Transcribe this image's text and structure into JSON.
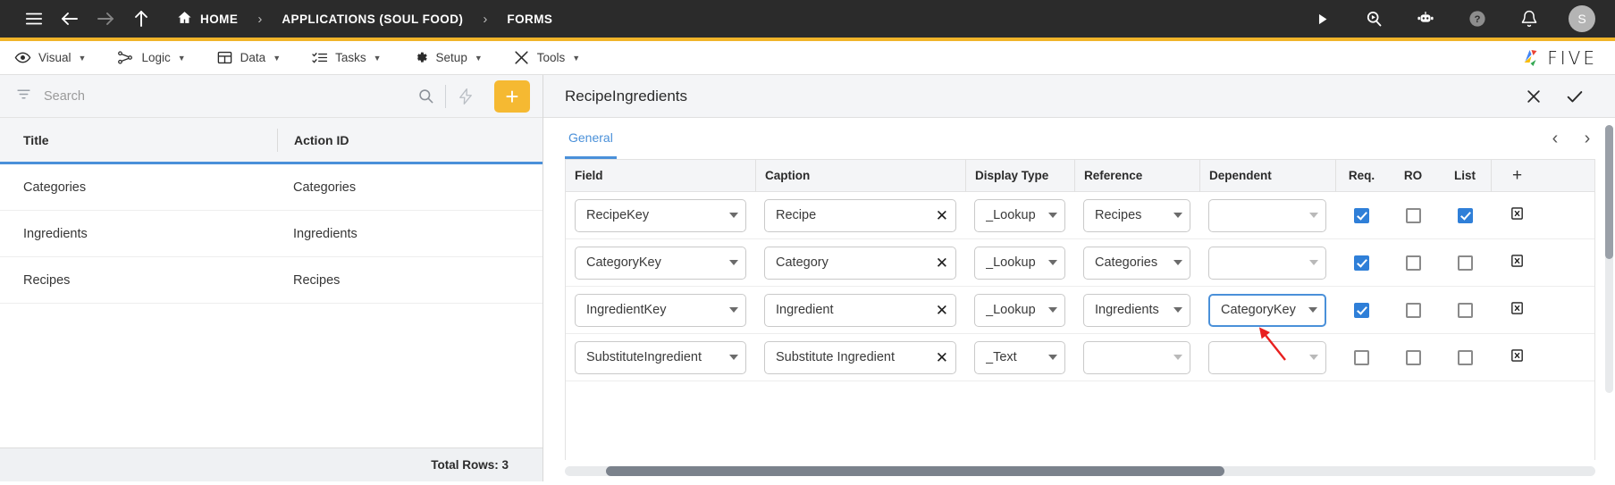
{
  "topbar": {
    "icons": {
      "menu": "hamburger-menu-icon",
      "back": "back-arrow-icon",
      "forward": "forward-arrow-icon",
      "up": "up-arrow-icon"
    },
    "breadcrumbs": [
      {
        "label": "HOME",
        "icon": "home-icon"
      },
      {
        "label": "APPLICATIONS (SOUL FOOD)",
        "icon": ""
      },
      {
        "label": "FORMS",
        "icon": ""
      }
    ],
    "separator": "›",
    "right_icons": [
      {
        "name": "play-icon"
      },
      {
        "name": "search-run-icon"
      },
      {
        "name": "chatbot-icon"
      },
      {
        "name": "help-icon"
      },
      {
        "name": "notifications-bell-icon"
      }
    ],
    "avatar_initial": "S",
    "accent_color": "#f0b429",
    "background_color": "#2b2b2b"
  },
  "menubar": {
    "items": [
      {
        "label": "Visual",
        "icon": "eye-icon",
        "caret": "▼"
      },
      {
        "label": "Logic",
        "icon": "logic-nodes-icon",
        "caret": "▼"
      },
      {
        "label": "Data",
        "icon": "table-grid-icon",
        "caret": "▼"
      },
      {
        "label": "Tasks",
        "icon": "checklist-icon",
        "caret": "▼"
      },
      {
        "label": "Setup",
        "icon": "gear-icon",
        "caret": "▼"
      },
      {
        "label": "Tools",
        "icon": "tools-wrench-icon",
        "caret": "▼"
      }
    ],
    "brand": "FIVE"
  },
  "left_panel": {
    "search": {
      "placeholder": "Search",
      "value": "",
      "filter_icon": "filter-icon",
      "search_icon": "search-icon",
      "lightning_icon": "lightning-bolt-icon",
      "add_label": "+"
    },
    "table": {
      "columns": [
        "Title",
        "Action ID"
      ],
      "rows": [
        {
          "title": "Categories",
          "action_id": "Categories"
        },
        {
          "title": "Ingredients",
          "action_id": "Ingredients"
        },
        {
          "title": "Recipes",
          "action_id": "Recipes"
        }
      ]
    },
    "footer": "Total Rows: 3"
  },
  "right_panel": {
    "title": "RecipeIngredients",
    "close_icon": "close-x-icon",
    "confirm_icon": "checkmark-icon",
    "tabs": [
      {
        "label": "General",
        "active": true
      }
    ],
    "pager": {
      "prev": "‹",
      "next": "›"
    },
    "grid": {
      "columns": [
        "Field",
        "Caption",
        "Display Type",
        "Reference",
        "Dependent",
        "Req.",
        "RO",
        "List"
      ],
      "add_column_label": "+",
      "rows": [
        {
          "field": "RecipeKey",
          "caption": "Recipe",
          "display_type": "_Lookup",
          "reference": "Recipes",
          "dependent": "",
          "req": true,
          "ro": false,
          "list": true,
          "dependent_highlighted": false,
          "delete_icon": "delete-row-icon"
        },
        {
          "field": "CategoryKey",
          "caption": "Category",
          "display_type": "_Lookup",
          "reference": "Categories",
          "dependent": "",
          "req": true,
          "ro": false,
          "list": false,
          "dependent_highlighted": false,
          "delete_icon": "delete-row-icon"
        },
        {
          "field": "IngredientKey",
          "caption": "Ingredient",
          "display_type": "_Lookup",
          "reference": "Ingredients",
          "dependent": "CategoryKey",
          "req": true,
          "ro": false,
          "list": false,
          "dependent_highlighted": true,
          "delete_icon": "delete-row-icon"
        },
        {
          "field": "SubstituteIngredient",
          "caption": "Substitute Ingredient",
          "display_type": "_Text",
          "reference": "",
          "dependent": "",
          "req": false,
          "ro": false,
          "list": false,
          "dependent_highlighted": false,
          "delete_icon": "delete-row-icon"
        }
      ],
      "clear_icon": "clear-x-icon"
    },
    "annotation": {
      "type": "red-arrow",
      "color": "#e8201f",
      "points_to": "CategoryKey"
    }
  }
}
